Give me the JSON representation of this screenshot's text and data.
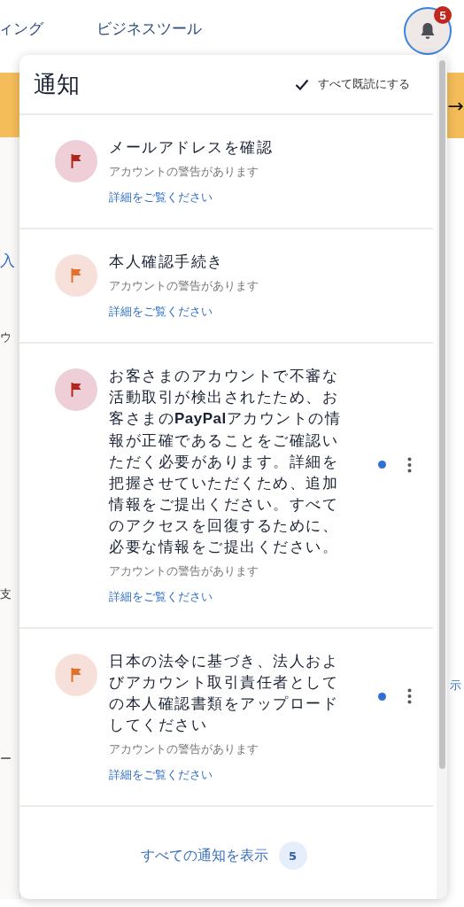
{
  "nav": {
    "items": [
      "ィング",
      "ビジネスツール"
    ],
    "notification_count": "5"
  },
  "background": {
    "left_fragments": [
      "入",
      "ウ",
      "支",
      "ー"
    ],
    "right_fragment": "示",
    "banner_arrow": "→"
  },
  "panel": {
    "title": "通知",
    "mark_all_read": "すべて既読にする",
    "notifications": [
      {
        "color": "#b3261e",
        "title": "メールアドレスを確認",
        "subtitle": "アカウントの警告があります",
        "link": "詳細をご覧ください",
        "unread": false
      },
      {
        "color": "#e0702a",
        "title": "本人確認手続き",
        "subtitle": "アカウントの警告があります",
        "link": "詳細をご覧ください",
        "unread": false
      },
      {
        "color": "#b3261e",
        "title": "お客さまのアカウントで不審な活動取引が検出されたため、お客さまの**PayPal**アカウントの情報が正確であることをご確認いただく必要があります。詳細を把握させていただくため、追加情報をご提出ください。すべてのアクセスを回復するために、必要な情報をご提出ください。",
        "subtitle": "アカウントの警告があります",
        "link": "詳細をご覧ください",
        "unread": true
      },
      {
        "color": "#e0702a",
        "title": "日本の法令に基づき、法人およびアカウント取引責任者としての本人確認書類をアップロードしてください",
        "subtitle": "アカウントの警告があります",
        "link": "詳細をご覧ください",
        "unread": true
      }
    ],
    "footer": {
      "link": "すべての通知を表示",
      "count": "5"
    }
  }
}
